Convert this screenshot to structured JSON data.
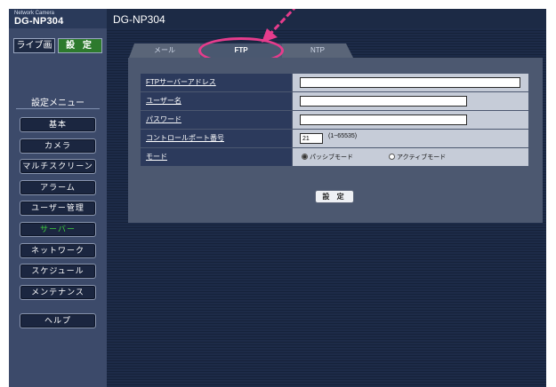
{
  "header": {
    "brand": "Network Camera",
    "model_left": "DG-NP304",
    "model_right": "DG-NP304"
  },
  "top_buttons": {
    "live": "ライブ画",
    "setup": "設 定"
  },
  "sidebar": {
    "menu_title": "設定メニュー",
    "items": [
      {
        "label": "基本"
      },
      {
        "label": "カメラ"
      },
      {
        "label": "マルチスクリーン"
      },
      {
        "label": "アラーム"
      },
      {
        "label": "ユーザー管理"
      },
      {
        "label": "サーバー"
      },
      {
        "label": "ネットワーク"
      },
      {
        "label": "スケジュール"
      },
      {
        "label": "メンテナンス"
      },
      {
        "label": "ヘルプ"
      }
    ],
    "active_item": "サーバー"
  },
  "tabs": [
    {
      "label": "メール"
    },
    {
      "label": "FTP"
    },
    {
      "label": "NTP"
    }
  ],
  "active_tab": "FTP",
  "form": {
    "ftp_server_label": "FTPサーバーアドレス",
    "ftp_server_value": "",
    "username_label": "ユーザー名",
    "username_value": "",
    "password_label": "パスワード",
    "password_value": "",
    "control_port_label": "コントロールポート番号",
    "control_port_value": "21",
    "control_port_range": "(1~65535)",
    "mode_label": "モード",
    "mode_passive": "パッシブモード",
    "mode_active": "アクティブモード",
    "mode_selected": "パッシブモード",
    "save_label": "設 定"
  },
  "colors": {
    "highlight_oval": "#e63c8c",
    "active_menu_text": "#3fd03f",
    "setup_button": "#2d7a2d"
  }
}
